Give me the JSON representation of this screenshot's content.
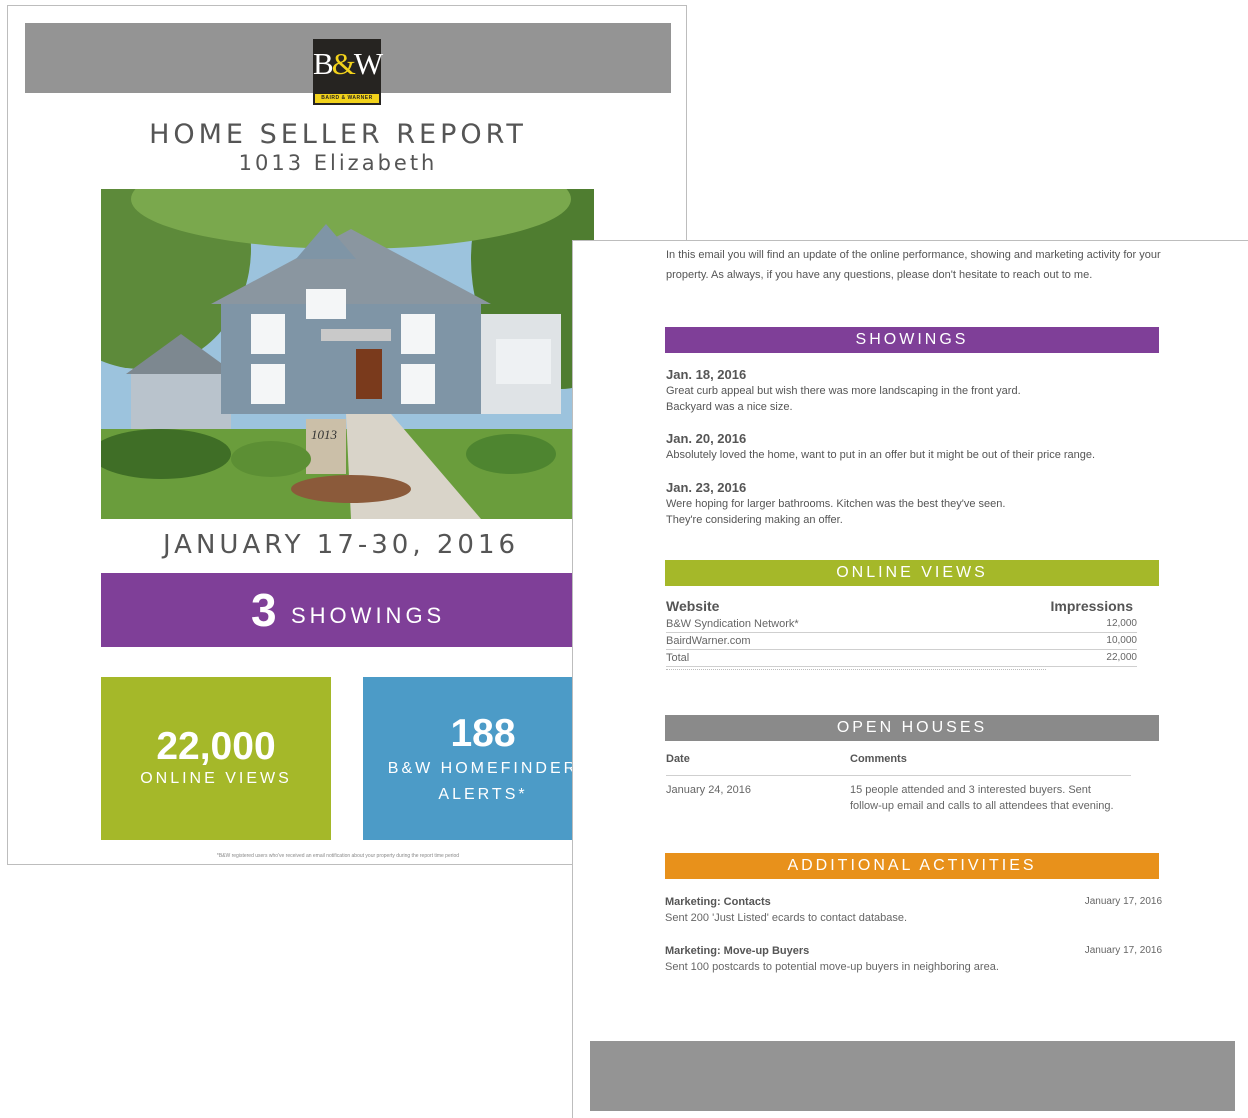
{
  "brand": {
    "logo_mark_b": "B",
    "logo_mark_amp": "&",
    "logo_mark_w": "W",
    "logo_caption": "BAIRD & WARNER",
    "colors": {
      "purple": "#7f3f98",
      "green": "#a5b829",
      "blue": "#4c9bc7",
      "orange": "#e8911b",
      "gray": "#949494",
      "logo_yellow": "#f2d21b"
    }
  },
  "cover": {
    "title": "HOME SELLER REPORT",
    "address": "1013 Elizabeth",
    "house_number_sign": "1013",
    "date_range": "JANUARY 17-30, 2016",
    "showings_count": "3",
    "showings_label": "SHOWINGS",
    "online_views_count": "22,000",
    "online_views_label": "ONLINE VIEWS",
    "alerts_count": "188",
    "alerts_label_line1": "B&W HOMEFINDER",
    "alerts_label_line2": "ALERTS*",
    "footnote": "*B&W registered users who've received an email notification about your property during the report time period"
  },
  "details": {
    "intro": "In this email you will find an update of the online performance, showing and marketing activity for your property.  As always, if you have any questions, please don't hesitate to reach out to me.",
    "showings_header": "SHOWINGS",
    "showings": [
      {
        "date": "Jan. 18, 2016",
        "line1": "Great curb appeal but wish there was more landscaping in the front yard.",
        "line2": "Backyard was a nice size."
      },
      {
        "date": "Jan. 20, 2016",
        "line1": "Absolutely loved the home, want to put in an offer but it might be out of their price range.",
        "line2": ""
      },
      {
        "date": "Jan. 23, 2016",
        "line1": "Were hoping for larger bathrooms. Kitchen was the best they've seen.",
        "line2": "They're considering making an offer."
      }
    ],
    "online_views_header": "ONLINE VIEWS",
    "online_views_table": {
      "col_website": "Website",
      "col_impressions": "Impressions",
      "rows": [
        {
          "site": "B&W Syndication Network*",
          "impressions": "12,000"
        },
        {
          "site": "BairdWarner.com",
          "impressions": "10,000"
        },
        {
          "site": "Total",
          "impressions": "22,000"
        }
      ]
    },
    "open_houses_header": "OPEN HOUSES",
    "open_houses_table": {
      "col_date": "Date",
      "col_comments": "Comments",
      "rows": [
        {
          "date": "January 24, 2016",
          "comment": "15 people attended and 3 interested buyers. Sent follow-up email and calls to all attendees that evening."
        }
      ]
    },
    "additional_header": "ADDITIONAL ACTIVITIES",
    "activities": [
      {
        "title": "Marketing: Contacts",
        "date": "January 17, 2016",
        "desc": "Sent 200 'Just Listed' ecards to contact database."
      },
      {
        "title": "Marketing: Move-up Buyers",
        "date": "January 17, 2016",
        "desc": "Sent 100 postcards to potential move-up buyers in neighboring area."
      }
    ]
  }
}
